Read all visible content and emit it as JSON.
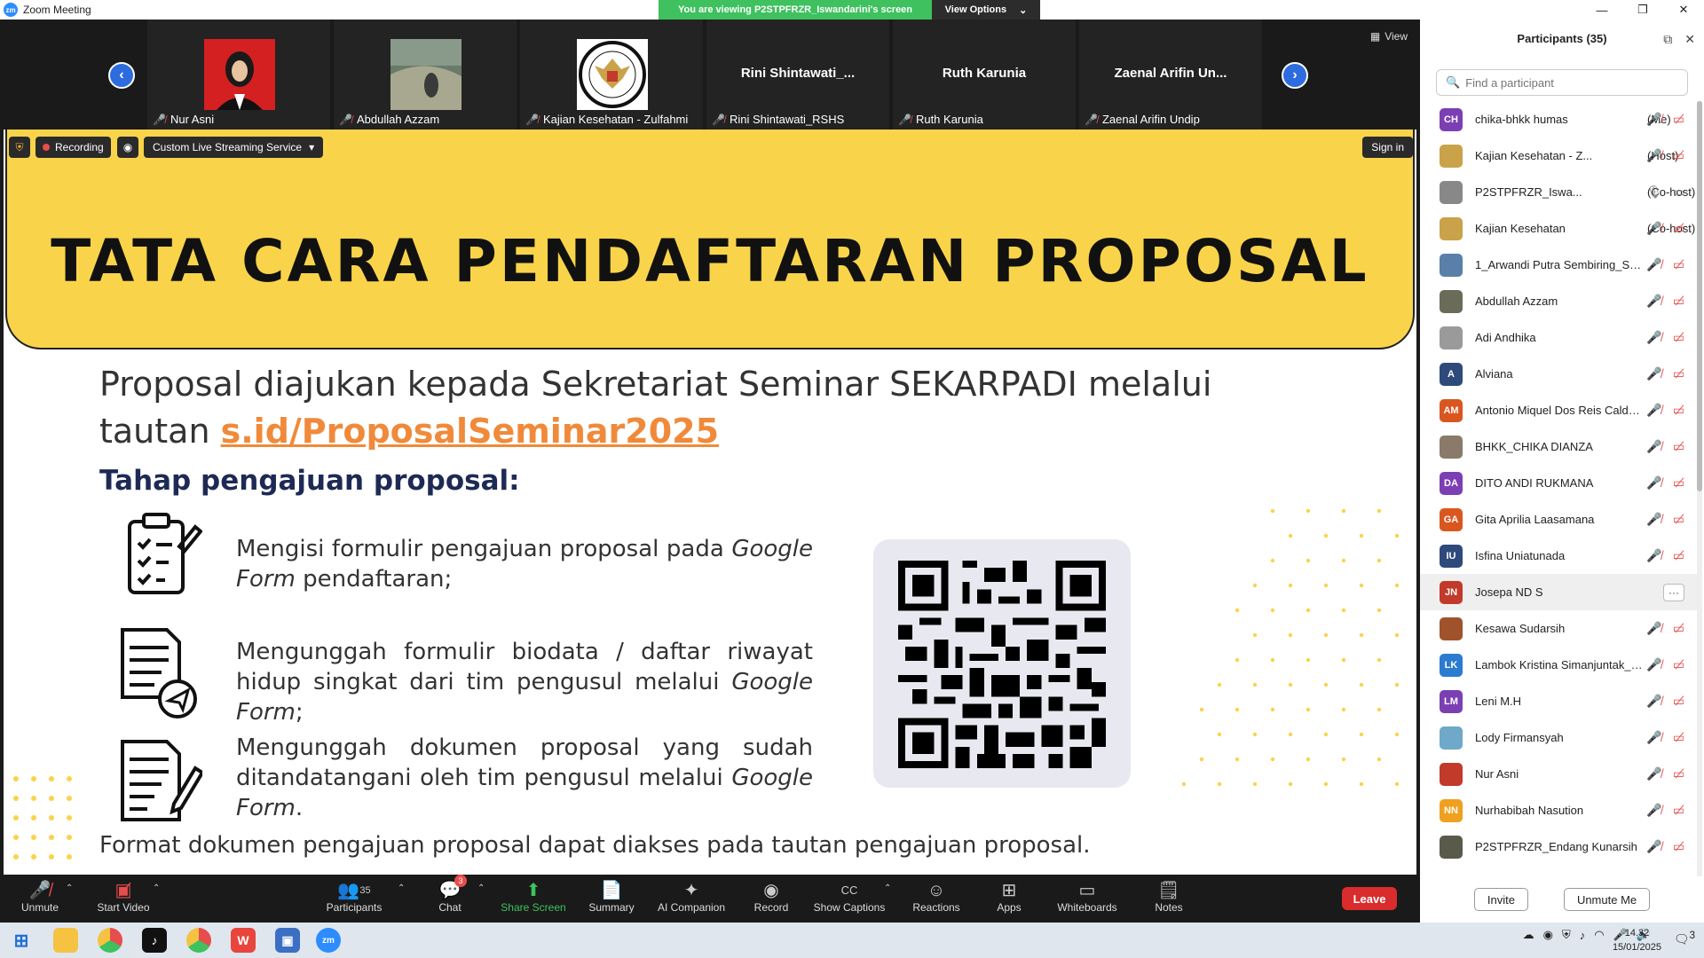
{
  "window": {
    "title": "Zoom Meeting",
    "logo": "zm"
  },
  "banner": {
    "viewing": "You are viewing P2STPFRZR_Iswandarini's screen",
    "view_options": "View Options"
  },
  "strip": {
    "view_label": "View",
    "tiles": [
      {
        "label": "Nur Asni",
        "big": ""
      },
      {
        "label": "Abdullah Azzam",
        "big": ""
      },
      {
        "label": "Kajian Kesehatan - Zulfahmi",
        "big": ""
      },
      {
        "label": "Rini Shintawati_RSHS",
        "big": "Rini  Shintawati_..."
      },
      {
        "label": "Ruth Karunia",
        "big": "Ruth Karunia"
      },
      {
        "label": "Zaenal Arifin Undip",
        "big": "Zaenal  Arifin  Un..."
      }
    ]
  },
  "overlay": {
    "recording": "Recording",
    "stream": "Custom Live Streaming Service",
    "signin": "Sign in"
  },
  "slide": {
    "title": "TATA CARA PENDAFTARAN PROPOSAL",
    "line1": "Proposal diajukan kepada Sekretariat Seminar SEKARPADI melalui",
    "line2_prefix": "tautan ",
    "link": "s.id/ProposalSeminar2025",
    "subtitle": "Tahap pengajuan proposal:",
    "step1a": "Mengisi formulir pengajuan proposal pada ",
    "step1b": "Google Form",
    "step1c": " pendaftaran;",
    "step2a": "Mengunggah formulir biodata / daftar riwayat hidup singkat dari tim pengusul melalui ",
    "step2b": "Google Form",
    "step2c": ";",
    "step3a": "Mengunggah dokumen proposal yang sudah ditandatangani oleh tim pengusul melalui ",
    "step3b": "Google Form",
    "step3c": ".",
    "footer": "Format dokumen pengajuan proposal dapat diakses pada tautan pengajuan proposal."
  },
  "controls": {
    "unmute": "Unmute",
    "start_video": "Start Video",
    "participants": "Participants",
    "participants_count": "35",
    "chat": "Chat",
    "chat_badge": "3",
    "share": "Share Screen",
    "summary": "Summary",
    "ai": "AI Companion",
    "record": "Record",
    "captions": "Show Captions",
    "reactions": "Reactions",
    "apps": "Apps",
    "whiteboards": "Whiteboards",
    "notes": "Notes",
    "leave": "Leave"
  },
  "panel": {
    "title": "Participants (35)",
    "search_placeholder": "Find a participant",
    "invite": "Invite",
    "unmute_me": "Unmute Me",
    "participants": [
      {
        "name": "chika-bhkk humas",
        "role": "(Me)",
        "initials": "CH",
        "color": "#7b3fb3"
      },
      {
        "name": "Kajian Kesehatan - Z...",
        "role": "(Host)",
        "initials": "",
        "color": "#c9a24a"
      },
      {
        "name": "P2STPFRZR_Iswa...",
        "role": "(Co-host)",
        "initials": "",
        "color": "#888888"
      },
      {
        "name": "Kajian Kesehatan",
        "role": "(Co-host)",
        "initials": "",
        "color": "#c9a24a"
      },
      {
        "name": "1_Arwandi Putra Sembiring_SH...",
        "role": "",
        "initials": "",
        "color": "#5a7fa8"
      },
      {
        "name": "Abdullah Azzam",
        "role": "",
        "initials": "",
        "color": "#6b6b5a"
      },
      {
        "name": "Adi Andhika",
        "role": "",
        "initials": "",
        "color": "#9a9a9a"
      },
      {
        "name": "Alviana",
        "role": "",
        "initials": "A",
        "color": "#2d4a7a"
      },
      {
        "name": "Antonio Miquel Dos Reis Calde...",
        "role": "",
        "initials": "AM",
        "color": "#d9571f"
      },
      {
        "name": "BHKK_CHIKA DIANZA",
        "role": "",
        "initials": "",
        "color": "#8a7a6a"
      },
      {
        "name": "DITO ANDI RUKMANA",
        "role": "",
        "initials": "DA",
        "color": "#7b3fb3"
      },
      {
        "name": "Gita Aprilia Laasamana",
        "role": "",
        "initials": "GA",
        "color": "#d9571f"
      },
      {
        "name": "Isfina Uniatunada",
        "role": "",
        "initials": "IU",
        "color": "#2d4a7a"
      },
      {
        "name": "Josepa ND S",
        "role": "",
        "initials": "JN",
        "color": "#c23a2a"
      },
      {
        "name": "Kesawa Sudarsih",
        "role": "",
        "initials": "",
        "color": "#a0522d"
      },
      {
        "name": "Lambok Kristina Simanjuntak_R...",
        "role": "",
        "initials": "LK",
        "color": "#2b7bd1"
      },
      {
        "name": "Leni M.H",
        "role": "",
        "initials": "LM",
        "color": "#7b3fb3"
      },
      {
        "name": "Lody Firmansyah",
        "role": "",
        "initials": "",
        "color": "#6fa8c8"
      },
      {
        "name": "Nur Asni",
        "role": "",
        "initials": "",
        "color": "#c23a2a"
      },
      {
        "name": "Nurhabibah Nasution",
        "role": "",
        "initials": "NN",
        "color": "#f0a020"
      },
      {
        "name": "P2STPFRZR_Endang Kunarsih",
        "role": "",
        "initials": "",
        "color": "#5a5a4a"
      }
    ]
  },
  "taskbar": {
    "time": "14.32",
    "date": "15/01/2025",
    "notif_count": "3"
  }
}
